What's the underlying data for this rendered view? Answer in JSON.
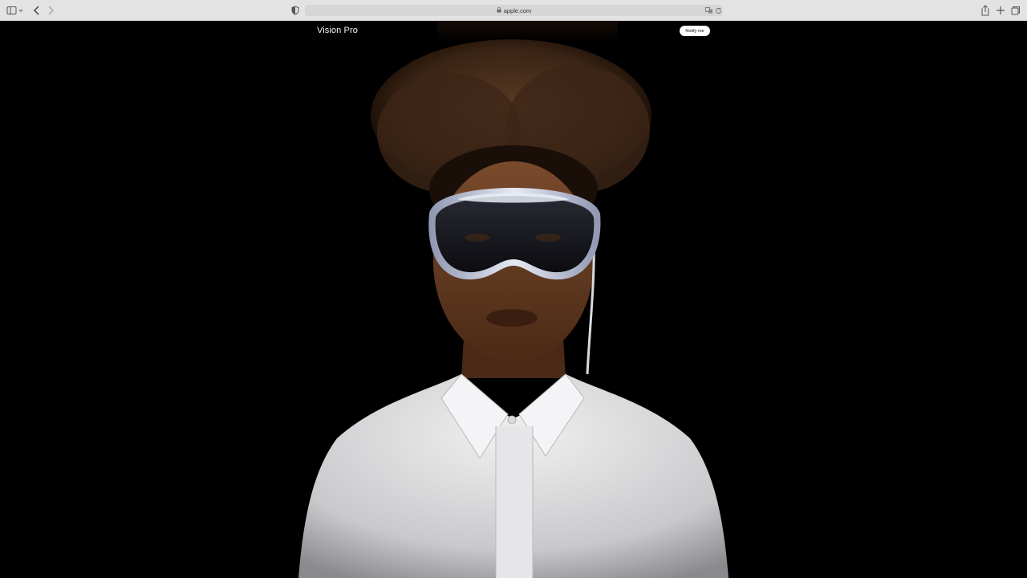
{
  "browser": {
    "address": "apple.com",
    "icons": {
      "sidebar": "sidebar-icon",
      "back": "chevron-left-icon",
      "forward": "chevron-right-icon",
      "privacy": "shield-icon",
      "lock": "lock-icon",
      "translate": "translate-icon",
      "reload": "reload-icon",
      "share": "share-icon",
      "new_tab": "plus-icon",
      "tabs": "tab-overview-icon"
    }
  },
  "page": {
    "product_title": "Vision Pro",
    "notify_label": "Notify me",
    "background": "#000000"
  }
}
